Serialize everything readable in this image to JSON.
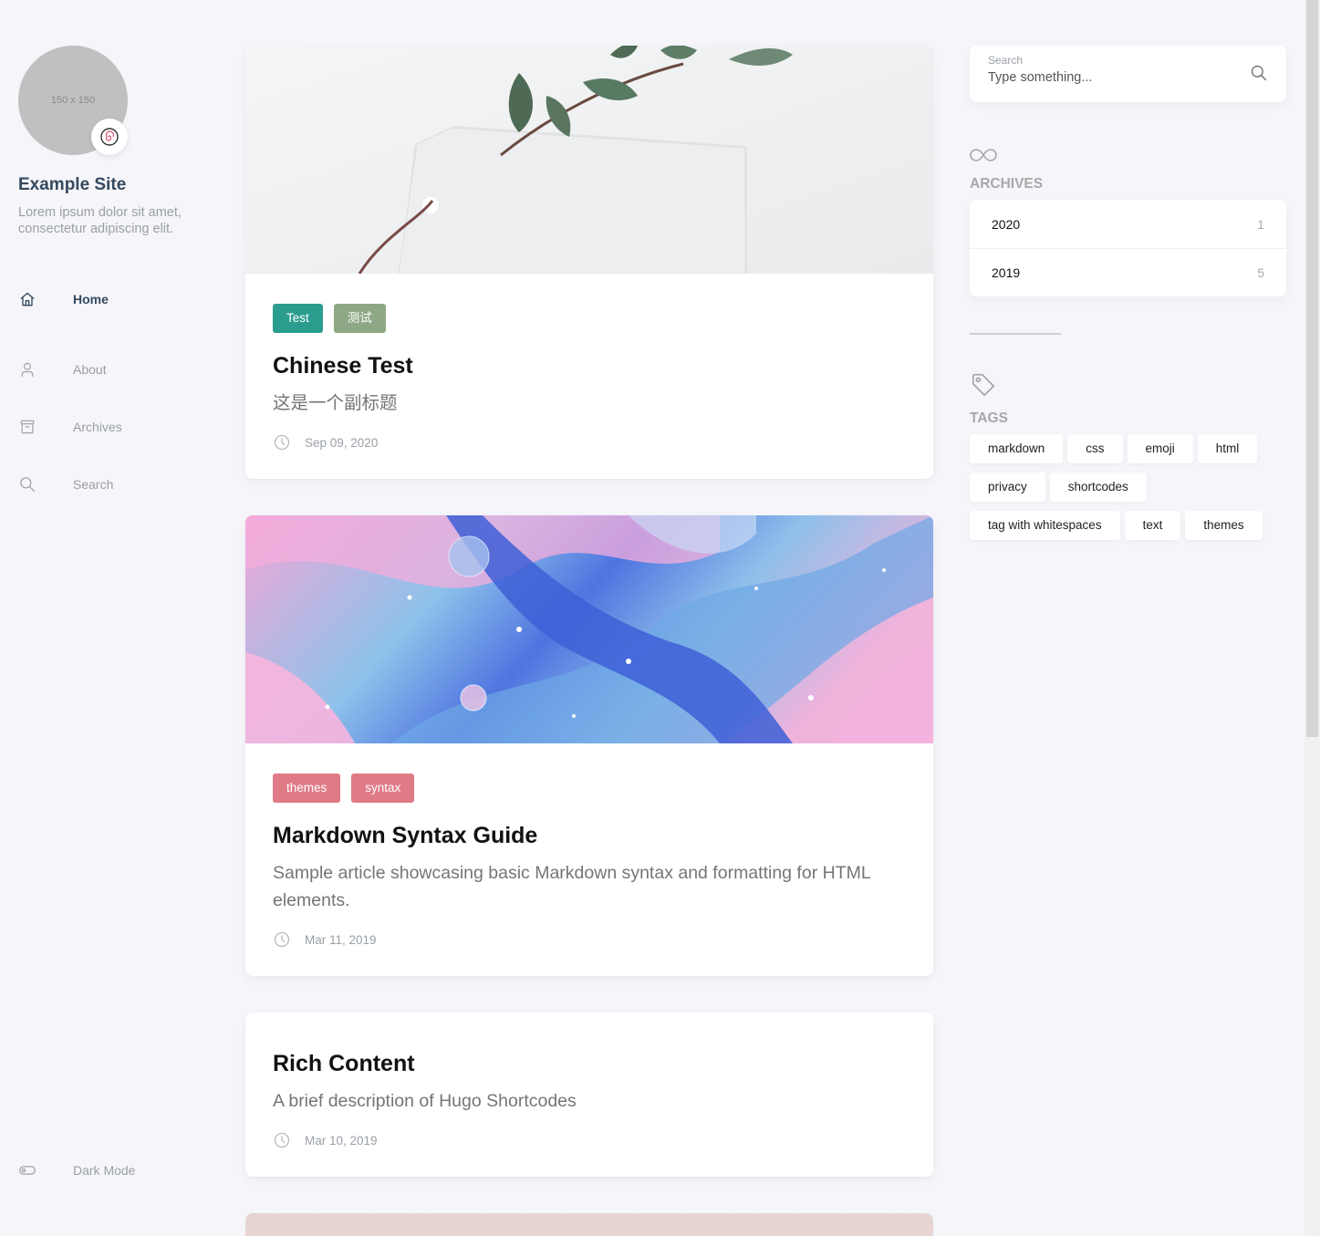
{
  "site": {
    "avatar_placeholder": "150 x 150",
    "emoji": "🍥",
    "name": "Example Site",
    "description": "Lorem ipsum dolor sit amet, consectetur adipiscing elit."
  },
  "menu": [
    {
      "label": "Home",
      "icon": "home-icon",
      "active": true
    },
    {
      "label": "About",
      "icon": "user-icon",
      "active": false
    },
    {
      "label": "Archives",
      "icon": "archive-icon",
      "active": false
    },
    {
      "label": "Search",
      "icon": "search-icon",
      "active": false
    }
  ],
  "dark_mode": {
    "label": "Dark Mode",
    "icon": "toggle-icon"
  },
  "posts": [
    {
      "categories": [
        {
          "label": "Test",
          "color": "#2a9d8f"
        },
        {
          "label": "测试",
          "color": "#8ea885"
        }
      ],
      "title": "Chinese Test",
      "subtitle": "这是一个副标题",
      "date": "Sep 09, 2020",
      "image": "eucalyptus-tag"
    },
    {
      "categories": [
        {
          "label": "themes",
          "color": "#e07a86"
        },
        {
          "label": "syntax",
          "color": "#e07a86"
        }
      ],
      "title": "Markdown Syntax Guide",
      "subtitle": "Sample article showcasing basic Markdown syntax and formatting for HTML elements.",
      "date": "Mar 11, 2019",
      "image": "fluid-art"
    },
    {
      "categories": [],
      "title": "Rich Content",
      "subtitle": "A brief description of Hugo Shortcodes",
      "date": "Mar 10, 2019",
      "image": ""
    }
  ],
  "search": {
    "label": "Search",
    "placeholder": "Type something..."
  },
  "archives": {
    "title": "ARCHIVES",
    "items": [
      {
        "year": "2020",
        "count": "1"
      },
      {
        "year": "2019",
        "count": "5"
      }
    ]
  },
  "tags": {
    "title": "TAGS",
    "items": [
      "markdown",
      "css",
      "emoji",
      "html",
      "privacy",
      "shortcodes",
      "tag with whitespaces",
      "text",
      "themes"
    ]
  }
}
